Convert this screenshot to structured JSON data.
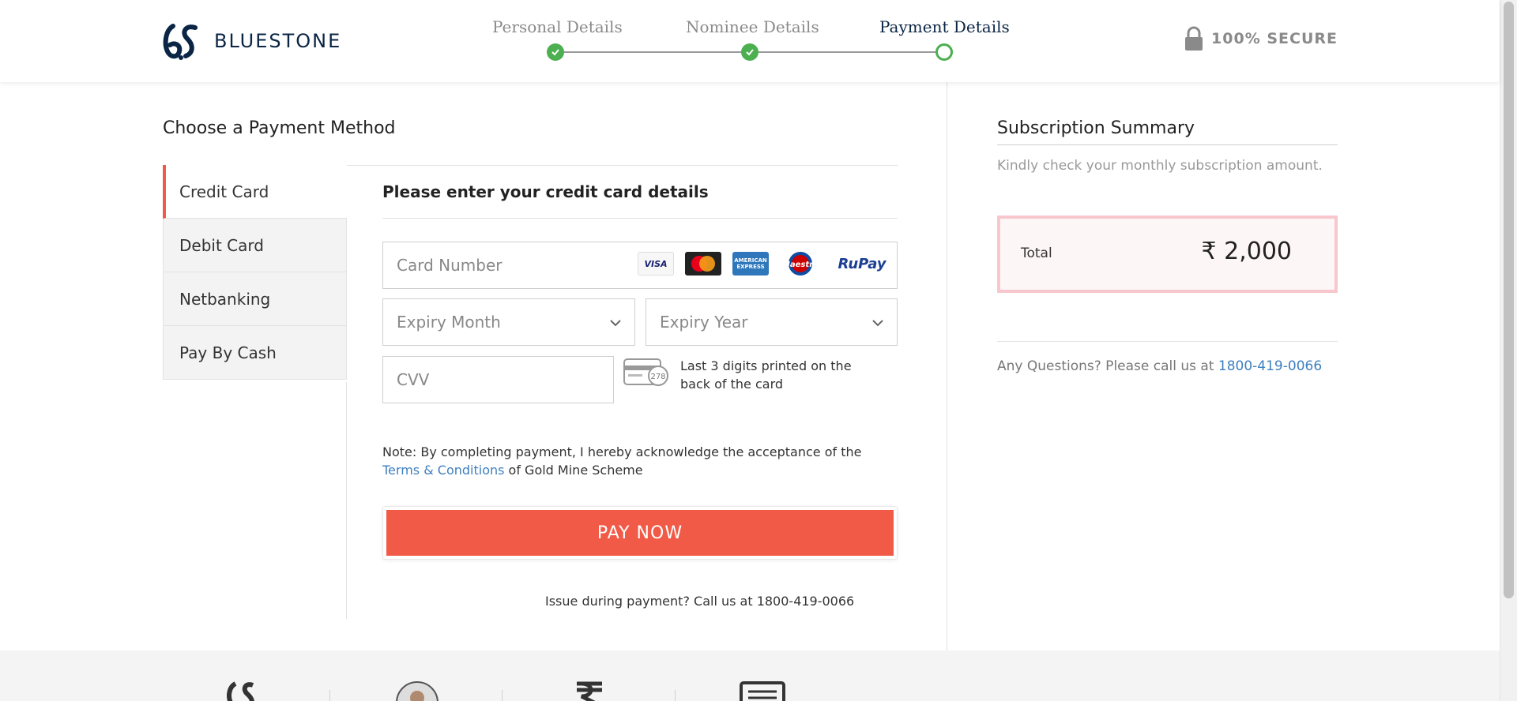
{
  "brand": {
    "name": "BLUESTONE",
    "color": "#0b2545"
  },
  "steps": [
    {
      "label": "Personal Details",
      "state": "done"
    },
    {
      "label": "Nominee Details",
      "state": "done"
    },
    {
      "label": "Payment Details",
      "state": "current"
    }
  ],
  "secure": {
    "label": "100% SECURE",
    "icon": "lock-icon"
  },
  "payment": {
    "title": "Choose a Payment Method",
    "methods": [
      {
        "label": "Credit Card",
        "active": true
      },
      {
        "label": "Debit Card",
        "active": false
      },
      {
        "label": "Netbanking",
        "active": false
      },
      {
        "label": "Pay By Cash",
        "active": false
      }
    ],
    "form_title": "Please enter your credit card details",
    "card_number_placeholder": "Card Number",
    "card_brands": [
      "VISA",
      "MasterCard",
      "AMERICAN EXPRESS",
      "Maestro",
      "RuPay"
    ],
    "expiry_month_placeholder": "Expiry Month",
    "expiry_year_placeholder": "Expiry Year",
    "cvv_placeholder": "CVV",
    "cvv_card_digits": "278",
    "cvv_hint": "Last 3 digits printed on the back of the card",
    "note_prefix": "Note: By completing payment, I hereby acknowledge the acceptance of the",
    "note_link": "Terms & Conditions",
    "note_suffix": " of Gold Mine Scheme",
    "pay_button": "PAY NOW",
    "issue_text": "Issue during payment? Call us at 1800-419-0066",
    "accent_color": "#f15a47"
  },
  "summary": {
    "title": "Subscription Summary",
    "subtitle": "Kindly check your monthly subscription amount.",
    "total_label": "Total",
    "total_amount": "₹ 2,000",
    "questions_prefix": "Any Questions? Please call us at ",
    "phone": "1800-419-0066"
  }
}
